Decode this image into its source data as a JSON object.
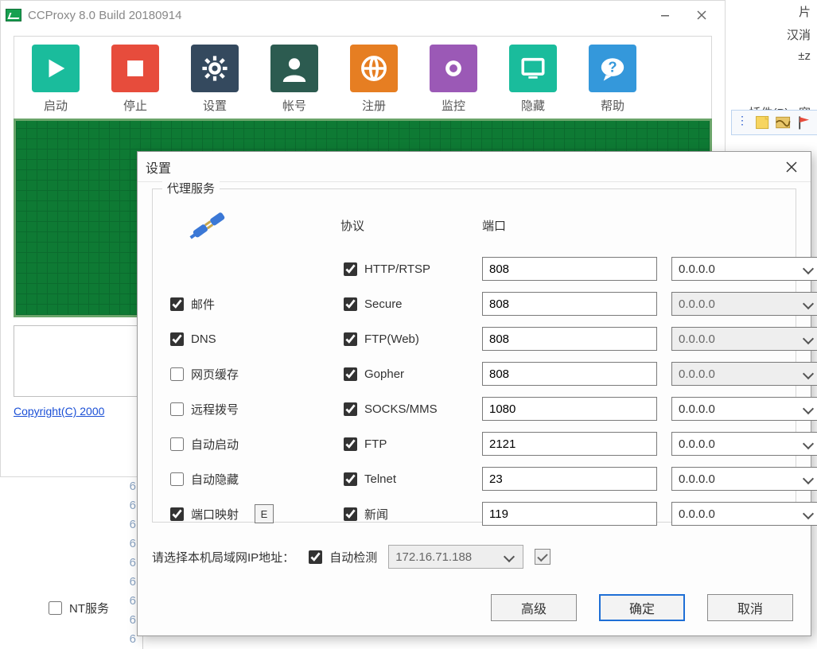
{
  "window": {
    "title": "CCProxy 8.0 Build 20180914"
  },
  "toolbar": [
    {
      "name": "start",
      "label": "启动",
      "color": "c-green"
    },
    {
      "name": "stop",
      "label": "停止",
      "color": "c-red"
    },
    {
      "name": "settings",
      "label": "设置",
      "color": "c-dark"
    },
    {
      "name": "account",
      "label": "帐号",
      "color": "c-teal"
    },
    {
      "name": "register",
      "label": "注册",
      "color": "c-orange"
    },
    {
      "name": "monitor",
      "label": "监控",
      "color": "c-purple"
    },
    {
      "name": "hide",
      "label": "隐藏",
      "color": "c-cyan"
    },
    {
      "name": "help",
      "label": "帮助",
      "color": "c-blue"
    }
  ],
  "copyright": "Copyright(C) 2000",
  "right_fragments": {
    "line1": "片",
    "line2": "汉消",
    "line3": "±z",
    "menu1": "插件(P)",
    "menu2": "窗"
  },
  "gutter_lines": [
    "6",
    "6",
    "6",
    "6",
    "6",
    "6",
    "6",
    "6",
    "6"
  ],
  "dialog": {
    "title": "设置",
    "group_label": "代理服务",
    "headers": {
      "protocol": "协议",
      "port": "端口"
    },
    "left_options": [
      {
        "name": "mail",
        "label": "邮件",
        "checked": true
      },
      {
        "name": "dns",
        "label": "DNS",
        "checked": true
      },
      {
        "name": "webcache",
        "label": "网页缓存",
        "checked": false
      },
      {
        "name": "remote-dial",
        "label": "远程拨号",
        "checked": false
      },
      {
        "name": "autostart",
        "label": "自动启动",
        "checked": false
      },
      {
        "name": "autohide",
        "label": "自动隐藏",
        "checked": false
      },
      {
        "name": "portmap",
        "label": "端口映射",
        "checked": true
      }
    ],
    "e_button": "E",
    "protocols": [
      {
        "name": "http-rtsp",
        "label": "HTTP/RTSP",
        "checked": true,
        "port": "808",
        "ip": "0.0.0.0",
        "ip_disabled": false
      },
      {
        "name": "secure",
        "label": "Secure",
        "checked": true,
        "port": "808",
        "ip": "0.0.0.0",
        "ip_disabled": true
      },
      {
        "name": "ftp-web",
        "label": "FTP(Web)",
        "checked": true,
        "port": "808",
        "ip": "0.0.0.0",
        "ip_disabled": true
      },
      {
        "name": "gopher",
        "label": "Gopher",
        "checked": true,
        "port": "808",
        "ip": "0.0.0.0",
        "ip_disabled": true
      },
      {
        "name": "socks-mms",
        "label": "SOCKS/MMS",
        "checked": true,
        "port": "1080",
        "ip": "0.0.0.0",
        "ip_disabled": false
      },
      {
        "name": "ftp",
        "label": "FTP",
        "checked": true,
        "port": "2121",
        "ip": "0.0.0.0",
        "ip_disabled": false
      },
      {
        "name": "telnet",
        "label": "Telnet",
        "checked": true,
        "port": "23",
        "ip": "0.0.0.0",
        "ip_disabled": false
      },
      {
        "name": "news",
        "label": "新闻",
        "checked": true,
        "port": "119",
        "ip": "0.0.0.0",
        "ip_disabled": false
      }
    ],
    "lan": {
      "label": "请选择本机局域网IP地址：",
      "auto_label": "自动检测",
      "auto_checked": true,
      "ip": "172.16.71.188"
    },
    "nt_service": {
      "label": "NT服务",
      "checked": false
    },
    "buttons": {
      "advanced": "高级",
      "ok": "确定",
      "cancel": "取消"
    }
  }
}
